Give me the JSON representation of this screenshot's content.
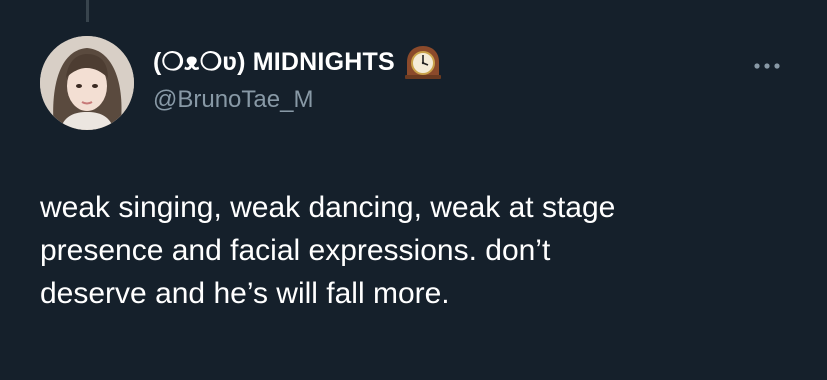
{
  "author": {
    "display_name": "(❍ᴥ❍ʋ) MIDNIGHTS",
    "handle": "@BrunoTae_M",
    "badge_icon": "mantelpiece-clock-icon",
    "avatar_icon": "profile-photo"
  },
  "tweet": {
    "text_lines": [
      "weak singing, weak dancing, weak at stage",
      "presence and facial expressions. don’t",
      "deserve and he’s will fall more."
    ]
  },
  "menu": {
    "icon": "more-options-icon"
  },
  "colors": {
    "background": "#15202b",
    "text": "#ffffff",
    "secondary_text": "#8899a6",
    "thread_line": "#38444d"
  }
}
